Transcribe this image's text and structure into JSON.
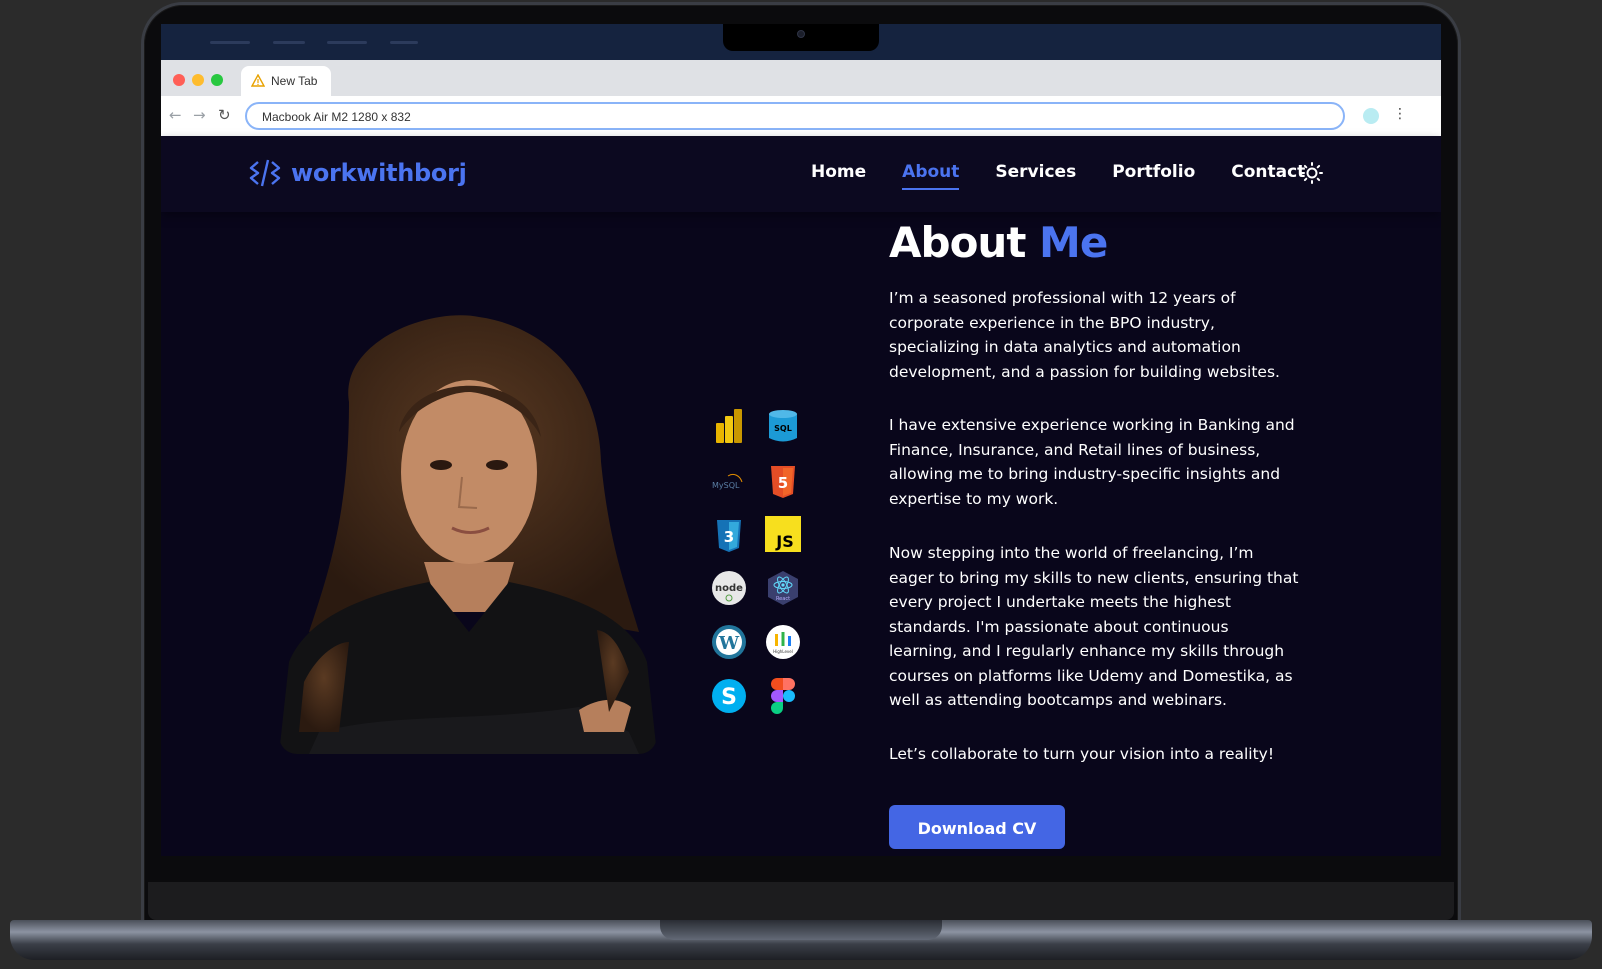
{
  "device": {
    "label": "Macbook Air M2",
    "resolution": "1280 x 832"
  },
  "browser": {
    "tab_title": "New Tab",
    "address": "Macbook Air M2   1280 x 832"
  },
  "site": {
    "logo_text": "workwithborj",
    "nav": [
      {
        "label": "Home",
        "active": false
      },
      {
        "label": "About",
        "active": true
      },
      {
        "label": "Services",
        "active": false
      },
      {
        "label": "Portfolio",
        "active": false
      },
      {
        "label": "Contact",
        "active": false
      }
    ],
    "theme_toggle_icon": "sun-icon",
    "accent_color": "#4b74f0",
    "background_color": "#09061b"
  },
  "about": {
    "title_main": "About ",
    "title_accent": "Me",
    "paragraphs": [
      "I’m a seasoned professional with 12 years of corporate experience in the BPO industry, specializing in data analytics and automation development, and a passion for building websites.",
      "I have extensive experience working in Banking and Finance, Insurance, and Retail lines of business, allowing me to bring industry-specific insights and expertise to my work.",
      "Now stepping into the world of freelancing, I’m eager to bring my skills to new clients, ensuring that every project I undertake meets the highest standards. I'm passionate about continuous learning, and I regularly enhance my skills through courses on platforms like Udemy and Domestika, as well as attending bootcamps and webinars.",
      "Let’s collaborate to turn your vision into a reality!"
    ],
    "download_button": "Download CV",
    "skills": [
      {
        "name": "powerbi-icon",
        "text": ""
      },
      {
        "name": "sql-icon",
        "text": "SQL"
      },
      {
        "name": "mysql-icon",
        "text": "MySQL"
      },
      {
        "name": "html5-icon",
        "text": "5"
      },
      {
        "name": "css3-icon",
        "text": "3"
      },
      {
        "name": "javascript-icon",
        "text": "JS"
      },
      {
        "name": "nodejs-icon",
        "text": "node"
      },
      {
        "name": "react-icon",
        "text": "React"
      },
      {
        "name": "wordpress-icon",
        "text": "W"
      },
      {
        "name": "highlevel-icon",
        "text": "HighLevel"
      },
      {
        "name": "skype-icon",
        "text": "S"
      },
      {
        "name": "figma-icon",
        "text": ""
      }
    ]
  }
}
